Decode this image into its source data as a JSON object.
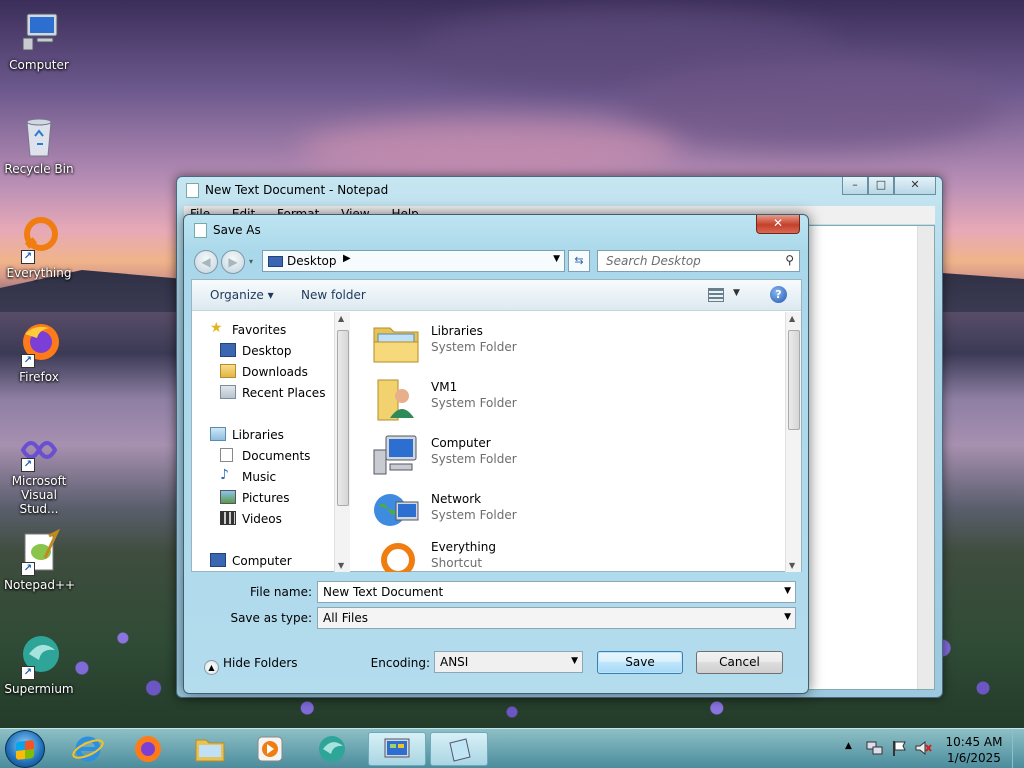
{
  "desktop": {
    "icons": [
      {
        "label": "Computer",
        "icon": "computer-icon"
      },
      {
        "label": "Recycle Bin",
        "icon": "recycle-bin-icon"
      },
      {
        "label": "Everything",
        "icon": "everything-icon"
      },
      {
        "label": "Firefox",
        "icon": "firefox-icon"
      },
      {
        "label": "Microsoft Visual Stud...",
        "icon": "visual-studio-icon"
      },
      {
        "label": "Notepad++",
        "icon": "notepad-plus-plus-icon"
      },
      {
        "label": "Supermium",
        "icon": "supermium-icon"
      }
    ]
  },
  "notepad": {
    "title": "New Text Document - Notepad",
    "menu": [
      "File",
      "Edit",
      "Format",
      "View",
      "Help"
    ],
    "controls": {
      "minimize": "–",
      "maximize": "□",
      "close": "✕"
    }
  },
  "dialog": {
    "title": "Save As",
    "close": "✕",
    "address": {
      "location": "Desktop",
      "separator": "▶"
    },
    "search": {
      "placeholder": "Search Desktop"
    },
    "toolbar": {
      "organize": "Organize",
      "organize_arrow": "▾",
      "new_folder": "New folder",
      "help": "?"
    },
    "nav": {
      "favorites": {
        "label": "Favorites",
        "items": [
          "Desktop",
          "Downloads",
          "Recent Places"
        ]
      },
      "libraries": {
        "label": "Libraries",
        "items": [
          "Documents",
          "Music",
          "Pictures",
          "Videos"
        ]
      },
      "computer": {
        "label": "Computer"
      }
    },
    "files": [
      {
        "name": "Libraries",
        "type": "System Folder",
        "icon": "libraries-folder-icon"
      },
      {
        "name": "VM1",
        "type": "System Folder",
        "icon": "user-folder-icon"
      },
      {
        "name": "Computer",
        "type": "System Folder",
        "icon": "computer-icon"
      },
      {
        "name": "Network",
        "type": "System Folder",
        "icon": "network-icon"
      },
      {
        "name": "Everything",
        "type": "Shortcut",
        "icon": "everything-icon"
      }
    ],
    "form": {
      "file_name_label": "File name:",
      "file_name_value": "New Text Document",
      "save_as_type_label": "Save as type:",
      "save_as_type_value": "All Files",
      "encoding_label": "Encoding:",
      "encoding_value": "ANSI"
    },
    "hide_folders": "Hide Folders",
    "save": "Save",
    "cancel": "Cancel"
  },
  "taskbar": {
    "pinned": [
      "internet-explorer-icon",
      "firefox-icon",
      "file-explorer-icon",
      "media-player-icon",
      "supermium-icon",
      "control-panel-icon",
      "notepad-icon"
    ],
    "tray": {
      "expand": "▲",
      "time": "10:45 AM",
      "date": "1/6/2025"
    }
  }
}
